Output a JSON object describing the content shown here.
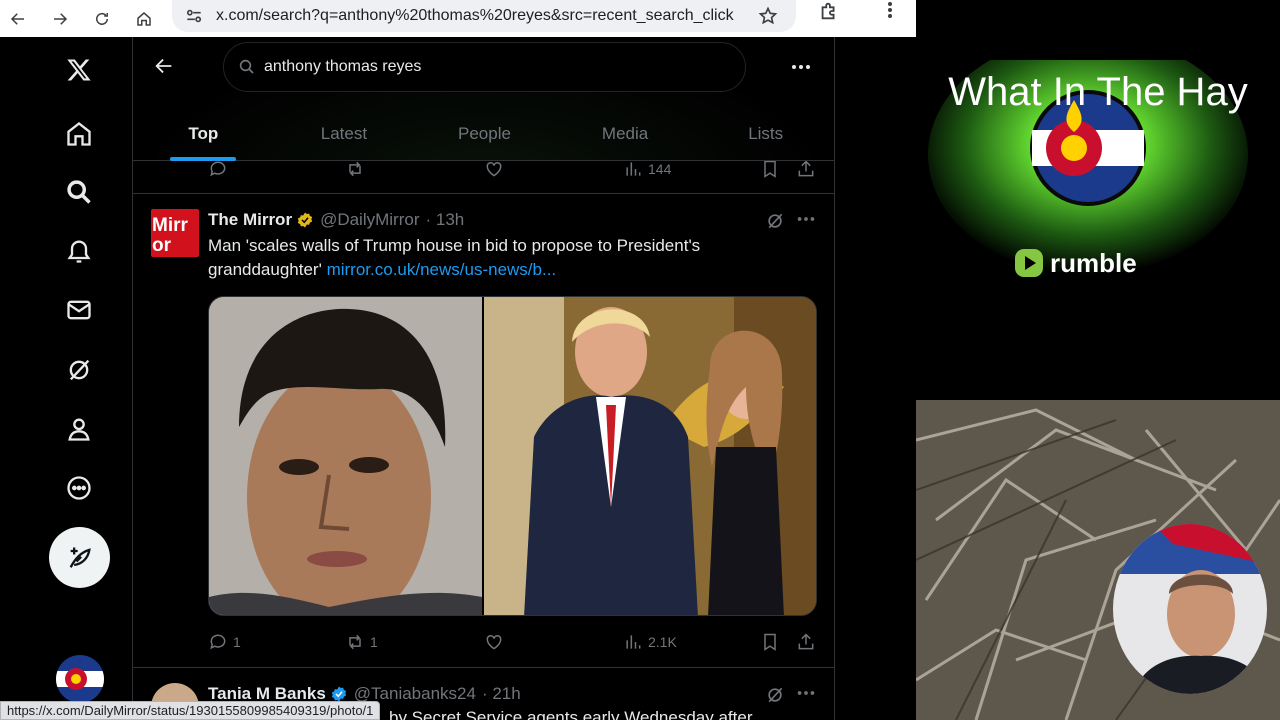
{
  "browser": {
    "url": "x.com/search?q=anthony%20thomas%20reyes&src=recent_search_click",
    "status_url": "https://x.com/DailyMirror/status/1930155809985409319/photo/1"
  },
  "search": {
    "query": "anthony thomas reyes"
  },
  "tabs": [
    {
      "label": "Top"
    },
    {
      "label": "Latest"
    },
    {
      "label": "People"
    },
    {
      "label": "Media"
    },
    {
      "label": "Lists"
    }
  ],
  "prev_tweet": {
    "views": "144"
  },
  "tweet": {
    "name": "The Mirror",
    "handle": "@DailyMirror",
    "time": "· 13h",
    "avatar_text": "Mirror",
    "text": "Man 'scales walls of Trump house in bid to propose to President's granddaughter'",
    "link": "mirror.co.uk/news/us-news/b...",
    "replies": "1",
    "reposts": "1",
    "views": "2.1K"
  },
  "next_tweet": {
    "name": "Tania M Banks",
    "handle": "@Taniabanks24",
    "time": "· 21h",
    "text_partial": "by Secret Service agents early Wednesday after"
  },
  "stream": {
    "title": "What In The Hay",
    "brand": "rumble"
  },
  "colors": {
    "accent": "#1d9bf0",
    "background": "#000000",
    "text": "#e7e9ea",
    "muted": "#71767b",
    "rumble_green": "#85c742"
  }
}
